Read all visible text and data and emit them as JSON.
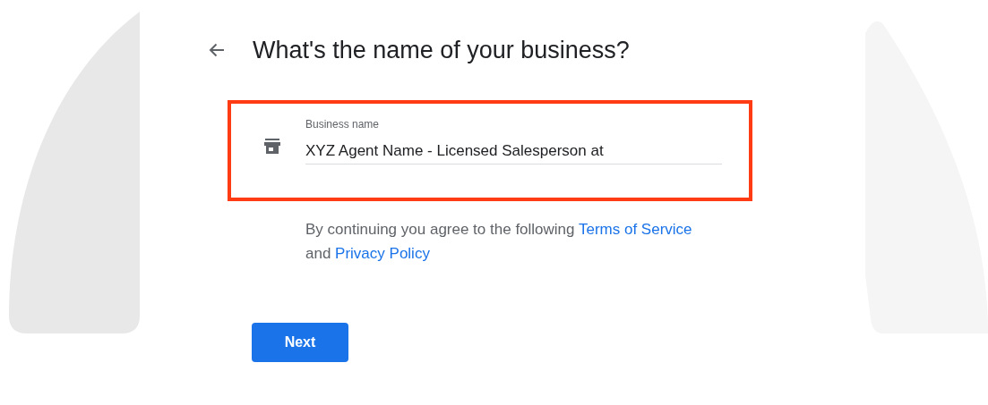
{
  "title": "What's the name of your business?",
  "field": {
    "label": "Business name",
    "value": "XYZ Agent Name - Licensed Salesperson at",
    "highlighted": true
  },
  "terms": {
    "before": "By continuing you agree to the following",
    "link_1": "Terms of Service",
    "middle": "and",
    "link_2": "Privacy Policy"
  },
  "buttons": [
    {
      "label": "Next",
      "kind": "primary"
    }
  ]
}
